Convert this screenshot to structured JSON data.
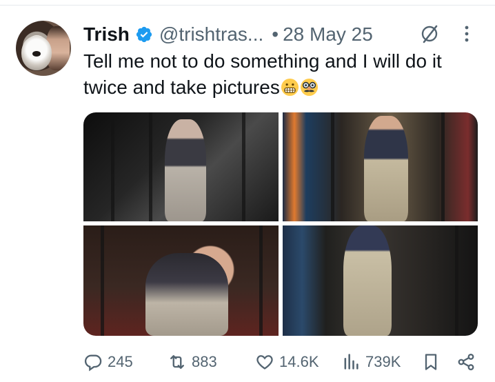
{
  "post": {
    "author": {
      "display_name": "Trish",
      "handle": "@trishtras...",
      "verified": true,
      "verified_color": "#1d9bf0"
    },
    "separator": "•",
    "date": "28 May 25",
    "text": "Tell me not to do something and I will do it twice and take pictures",
    "emojis": [
      "grimacing-face",
      "disguised-face"
    ],
    "header_icons": [
      "grok-icon",
      "more-icon"
    ],
    "media": [
      {
        "name": "photo-1",
        "alt": ""
      },
      {
        "name": "photo-2",
        "alt": ""
      },
      {
        "name": "photo-3",
        "alt": ""
      },
      {
        "name": "photo-4",
        "alt": ""
      }
    ],
    "stats": {
      "replies": "245",
      "reposts": "883",
      "likes": "14.6K",
      "views": "739K"
    }
  },
  "colors": {
    "text_primary": "#0f1419",
    "text_secondary": "#536471",
    "divider": "#e6e9ec"
  }
}
